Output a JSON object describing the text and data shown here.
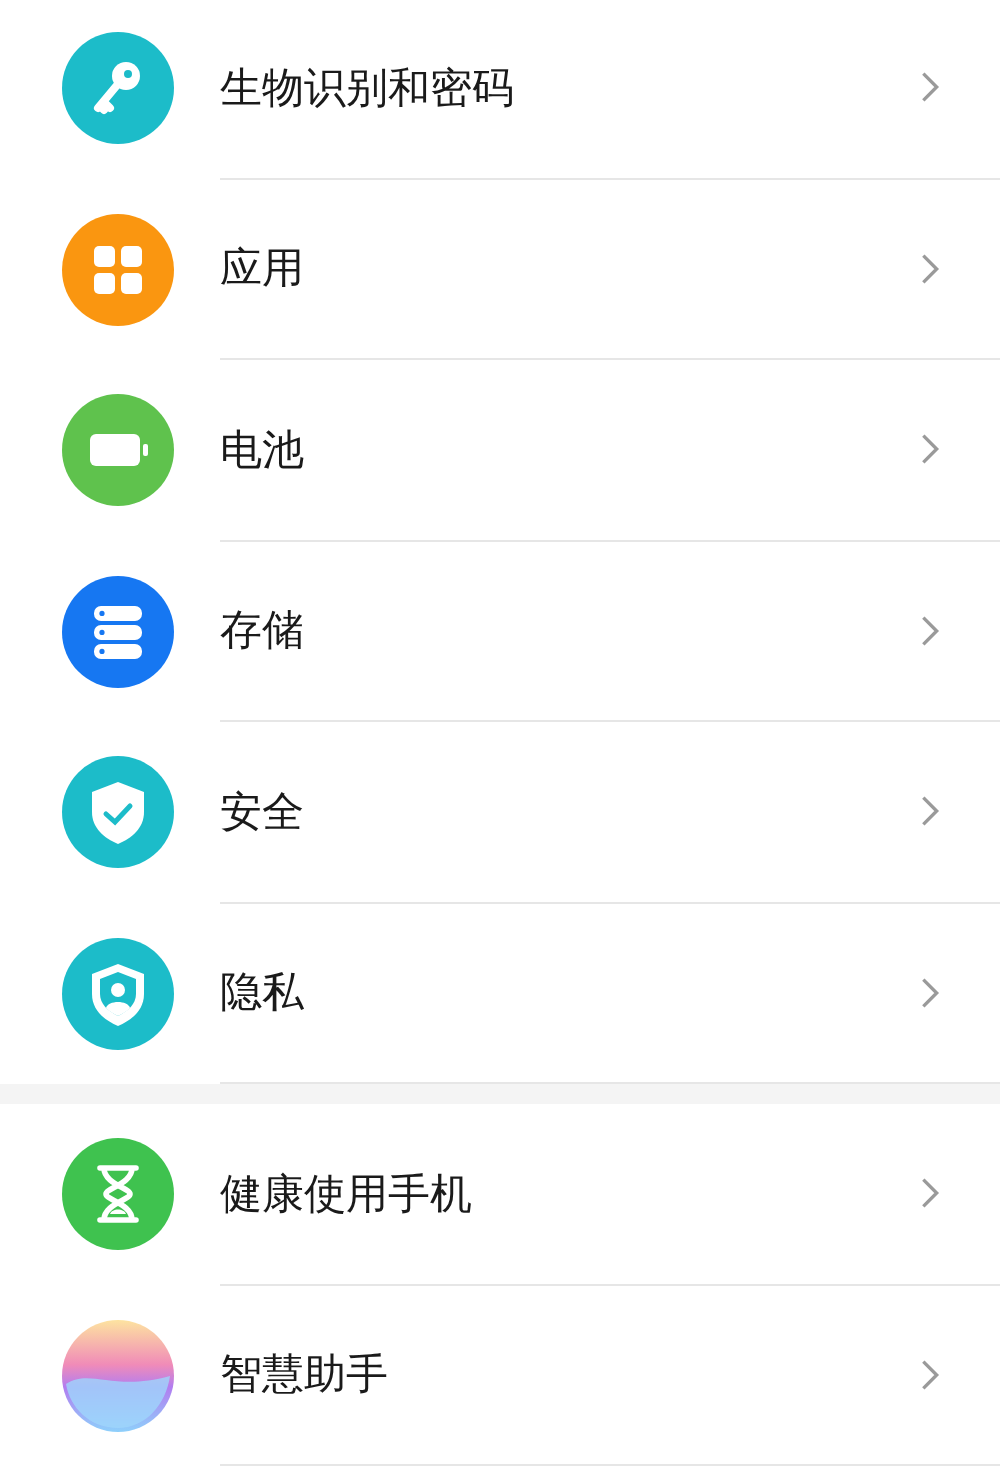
{
  "groups": [
    {
      "items": [
        {
          "label": "生物识别和密码"
        },
        {
          "label": "应用"
        },
        {
          "label": "电池"
        },
        {
          "label": "存储"
        },
        {
          "label": "安全"
        },
        {
          "label": "隐私"
        }
      ]
    },
    {
      "items": [
        {
          "label": "健康使用手机"
        },
        {
          "label": "智慧助手"
        }
      ]
    }
  ]
}
